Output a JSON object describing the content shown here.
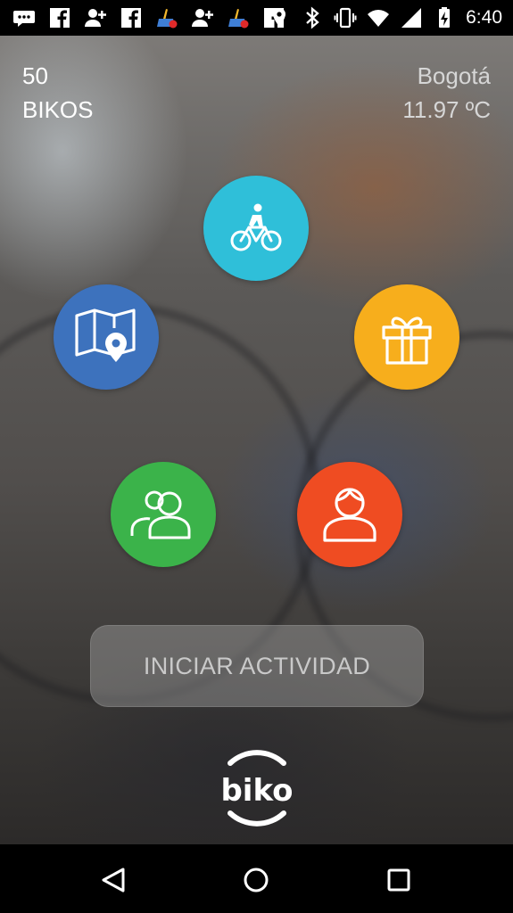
{
  "status_bar": {
    "time": "6:40",
    "left_icons": [
      "messenger-icon",
      "facebook-icon",
      "add-user-icon",
      "facebook-icon",
      "cleaner-icon",
      "add-user-icon",
      "cleaner-icon",
      "facebook-icon"
    ],
    "right_icons": [
      "location-icon",
      "bluetooth-icon",
      "vibrate-icon",
      "wifi-icon",
      "signal-icon",
      "battery-charging-icon"
    ]
  },
  "header": {
    "bikos_count": "50",
    "bikos_label": "BIKOS",
    "city": "Bogotá",
    "temperature": "11.97 ºC"
  },
  "menu": {
    "buttons": [
      {
        "name": "ride",
        "icon": "cyclist-icon",
        "color": "#2fbfd9"
      },
      {
        "name": "map",
        "icon": "map-pin-icon",
        "color": "#3d72bd"
      },
      {
        "name": "gift",
        "icon": "gift-icon",
        "color": "#f7ae1c"
      },
      {
        "name": "friends",
        "icon": "group-icon",
        "color": "#3bb34a"
      },
      {
        "name": "profile",
        "icon": "user-icon",
        "color": "#ef4c22"
      }
    ]
  },
  "start_button": {
    "label": "INICIAR ACTIVIDAD"
  },
  "logo": {
    "text": "biko"
  },
  "nav_bar": {
    "buttons": [
      "back-icon",
      "home-icon",
      "recent-apps-icon"
    ]
  }
}
